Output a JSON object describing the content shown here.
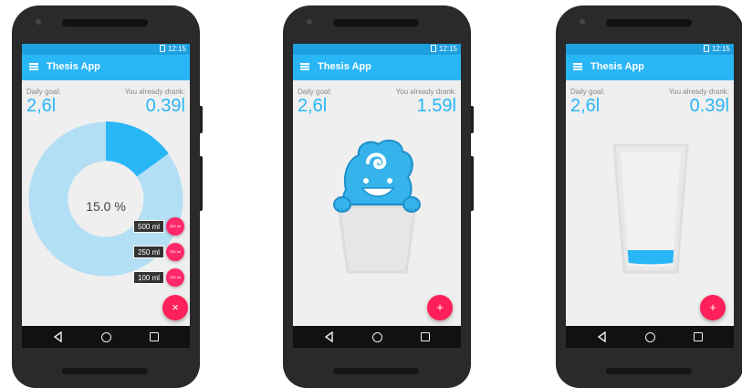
{
  "app": {
    "title": "Thesis App",
    "status_time": "12:15"
  },
  "labels": {
    "daily_goal": "Daily goal:",
    "already_drank": "You already drank:"
  },
  "screens": [
    {
      "daily_goal_value": "2,6l",
      "drank_value": "0.39l",
      "progress_percent_text": "15.0 %",
      "progress_fraction": 0.15,
      "fab_icon": "×",
      "quick_add": [
        {
          "label": "500 ml",
          "button": "500 ml"
        },
        {
          "label": "250 ml",
          "button": "250 ml"
        },
        {
          "label": "100 ml",
          "button": "100 ml"
        }
      ]
    },
    {
      "daily_goal_value": "2,6l",
      "drank_value": "1.59l",
      "fab_icon": "+"
    },
    {
      "daily_goal_value": "2,6l",
      "drank_value": "0.39l",
      "fill_fraction": 0.15,
      "fab_icon": "+"
    }
  ],
  "colors": {
    "primary": "#29b6f6",
    "primary_dark": "#1e9fe0",
    "accent": "#ff1f5a",
    "donut_track": "#b3dff5"
  }
}
